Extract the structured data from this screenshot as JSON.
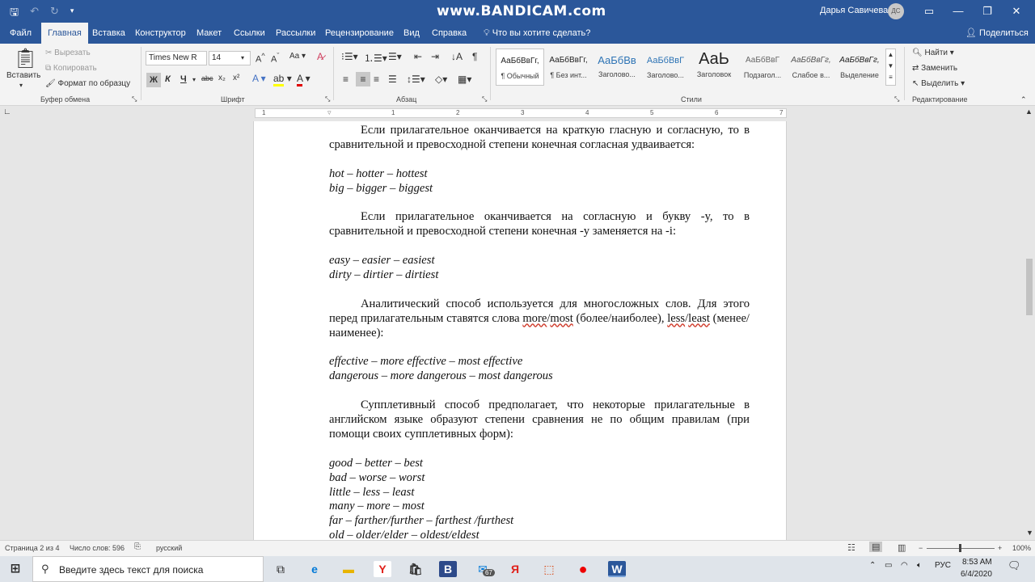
{
  "watermark": "www.BANDICAM.com",
  "user": {
    "name": "Дарья Савичева",
    "initials": "ДС"
  },
  "menu": {
    "tabs": [
      "Файл",
      "Главная",
      "Вставка",
      "Конструктор",
      "Макет",
      "Ссылки",
      "Рассылки",
      "Рецензирование",
      "Вид",
      "Справка"
    ],
    "tell_me": "Что вы хотите сделать?",
    "share": "Поделиться"
  },
  "clipboard": {
    "paste": "Вставить",
    "cut": "Вырезать",
    "copy": "Копировать",
    "format_painter": "Формат по образцу",
    "label": "Буфер обмена"
  },
  "font": {
    "name": "Times New R",
    "size": "14",
    "label": "Шрифт",
    "bold": "Ж",
    "italic": "К",
    "underline": "Ч",
    "strike": "abc",
    "sub": "x₂",
    "sup": "x²"
  },
  "paragraph": {
    "label": "Абзац"
  },
  "styles": {
    "label": "Стили",
    "items": [
      {
        "preview": "АаБбВвГг,",
        "name": "¶ Обычный"
      },
      {
        "preview": "АаБбВвГг,",
        "name": "¶ Без инт..."
      },
      {
        "preview": "АаБбВв",
        "name": "Заголово..."
      },
      {
        "preview": "АаБбВвГ",
        "name": "Заголово..."
      },
      {
        "preview": "АаЬ",
        "name": "Заголовок"
      },
      {
        "preview": "АаБбВвГ",
        "name": "Подзагол..."
      },
      {
        "preview": "АаБбВвГг,",
        "name": "Слабое в..."
      },
      {
        "preview": "АаБбВвГг,",
        "name": "Выделение"
      }
    ]
  },
  "editing": {
    "find": "Найти",
    "replace": "Заменить",
    "select": "Выделить",
    "label": "Редактирование"
  },
  "ruler": {
    "numbers": [
      "1",
      "1",
      "2",
      "3",
      "4",
      "5",
      "6",
      "7"
    ]
  },
  "doc": {
    "p1": "Если прилагательное оканчивается на краткую гласную и согласную, то в сравнительной и превосходной степени конечная согласная удваивается:",
    "ex1": [
      "hot – hotter – hottest",
      "big – bigger – biggest"
    ],
    "p2": "Если прилагательное оканчивается на согласную и букву -y, то в сравнительной и превосходной степени конечная -y заменяется на -i:",
    "ex2": [
      "easy – easier – easiest",
      "dirty – dirtier – dirtiest"
    ],
    "p3a": "Аналитический способ используется для многосложных слов. Для этого перед прилагательным ставятся слова ",
    "p3_more": "more",
    "p3_slash1": "/",
    "p3_most": "most",
    "p3b": " (более/наиболее), ",
    "p3_less": "less",
    "p3_slash2": "/",
    "p3_least": "least",
    "p3c": " (менее/наименее):",
    "ex3": [
      "effective – more effective – most effective",
      "dangerous – more dangerous – most dangerous"
    ],
    "p4": "Супплетивный способ предполагает, что некоторые прилагательные в английском языке образуют степени сравнения не по общим правилам (при помощи своих супплетивных форм):",
    "ex4": [
      "good – better – best",
      "bad – worse – worst",
      "little – less – least",
      "many – more – most",
      "far – farther/further – farthest /furthest",
      "old – older/elder – oldest/eldest"
    ]
  },
  "status": {
    "page": "Страница 2 из 4",
    "words": "Число слов: 596",
    "lang": "русский",
    "zoom": "100%"
  },
  "taskbar": {
    "search_placeholder": "Введите здесь текст для поиска",
    "mail_badge": "67",
    "lang": "РУС",
    "time": "8:53 AM",
    "date": "6/4/2020"
  }
}
